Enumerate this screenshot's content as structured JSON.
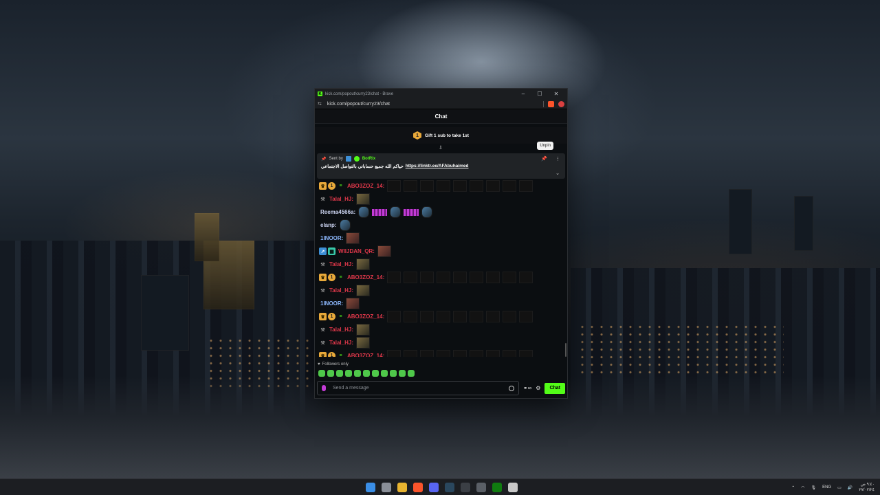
{
  "browser": {
    "title": "kick.com/popout/curry23/chat - Brave",
    "url": "kick.com/popout/curry23/chat"
  },
  "chat": {
    "header": "Chat",
    "gift_count": "1",
    "gift_text": "Gift 1 sub to take 1st",
    "unpin_tooltip": "Unpin",
    "pinned": {
      "sent_by": "Sent by",
      "bot_name": "BotRix",
      "message": "حياكم الله جميع حساباتي بالتواصل الاجتماعي",
      "link": "https://linktr.ee/AFAbuhaimed"
    },
    "messages": [
      {
        "user": "ABO3ZOZ_14:",
        "color": "red",
        "badges": [
          "crown",
          "one",
          "gift"
        ],
        "emotes": 9,
        "emote_type": "dark"
      },
      {
        "user": "Talal_HJ:",
        "color": "red",
        "badges": [
          "hammer"
        ],
        "emotes": 1,
        "emote_type": "pic"
      },
      {
        "user": "Reema4566a:",
        "color": "white",
        "badges": [],
        "emotes": 5,
        "emote_type": "mixed"
      },
      {
        "user": "elanp:",
        "color": "white",
        "badges": [],
        "emotes": 1,
        "emote_type": "fish"
      },
      {
        "user": "1INOOR:",
        "color": "blue",
        "badges": [],
        "emotes": 1,
        "emote_type": "face"
      },
      {
        "user": "WIIJDAN_QR:",
        "color": "red",
        "badges": [
          "blue",
          "grid"
        ],
        "emotes": 1,
        "emote_type": "face"
      },
      {
        "user": "Talal_HJ:",
        "color": "red",
        "badges": [
          "hammer"
        ],
        "emotes": 1,
        "emote_type": "pic"
      },
      {
        "user": "ABO3ZOZ_14:",
        "color": "red",
        "badges": [
          "crown",
          "one",
          "gift"
        ],
        "emotes": 9,
        "emote_type": "dark"
      },
      {
        "user": "Talal_HJ:",
        "color": "red",
        "badges": [
          "hammer"
        ],
        "emotes": 1,
        "emote_type": "pic"
      },
      {
        "user": "1INOOR:",
        "color": "blue",
        "badges": [],
        "emotes": 1,
        "emote_type": "face"
      },
      {
        "user": "ABO3ZOZ_14:",
        "color": "red",
        "badges": [
          "crown",
          "one",
          "gift"
        ],
        "emotes": 9,
        "emote_type": "dark"
      },
      {
        "user": "Talal_HJ:",
        "color": "red",
        "badges": [
          "hammer"
        ],
        "emotes": 1,
        "emote_type": "pic"
      },
      {
        "user": "Talal_HJ:",
        "color": "red",
        "badges": [
          "hammer"
        ],
        "emotes": 1,
        "emote_type": "pic"
      },
      {
        "user": "ABO3ZOZ_14:",
        "color": "red",
        "badges": [
          "crown",
          "one",
          "gift"
        ],
        "emotes": 9,
        "emote_type": "dark"
      }
    ],
    "followers_only": "Followers only",
    "input_placeholder": "Send a message",
    "chat_button": "Chat"
  },
  "taskbar": {
    "language": "ENG",
    "time": "٩:٤٠ ص",
    "date": "٢٧/٠٢/٢٤"
  },
  "colors": {
    "kick_green": "#53fc18",
    "username_red": "#e0384a",
    "username_blue": "#8ab4f8"
  }
}
